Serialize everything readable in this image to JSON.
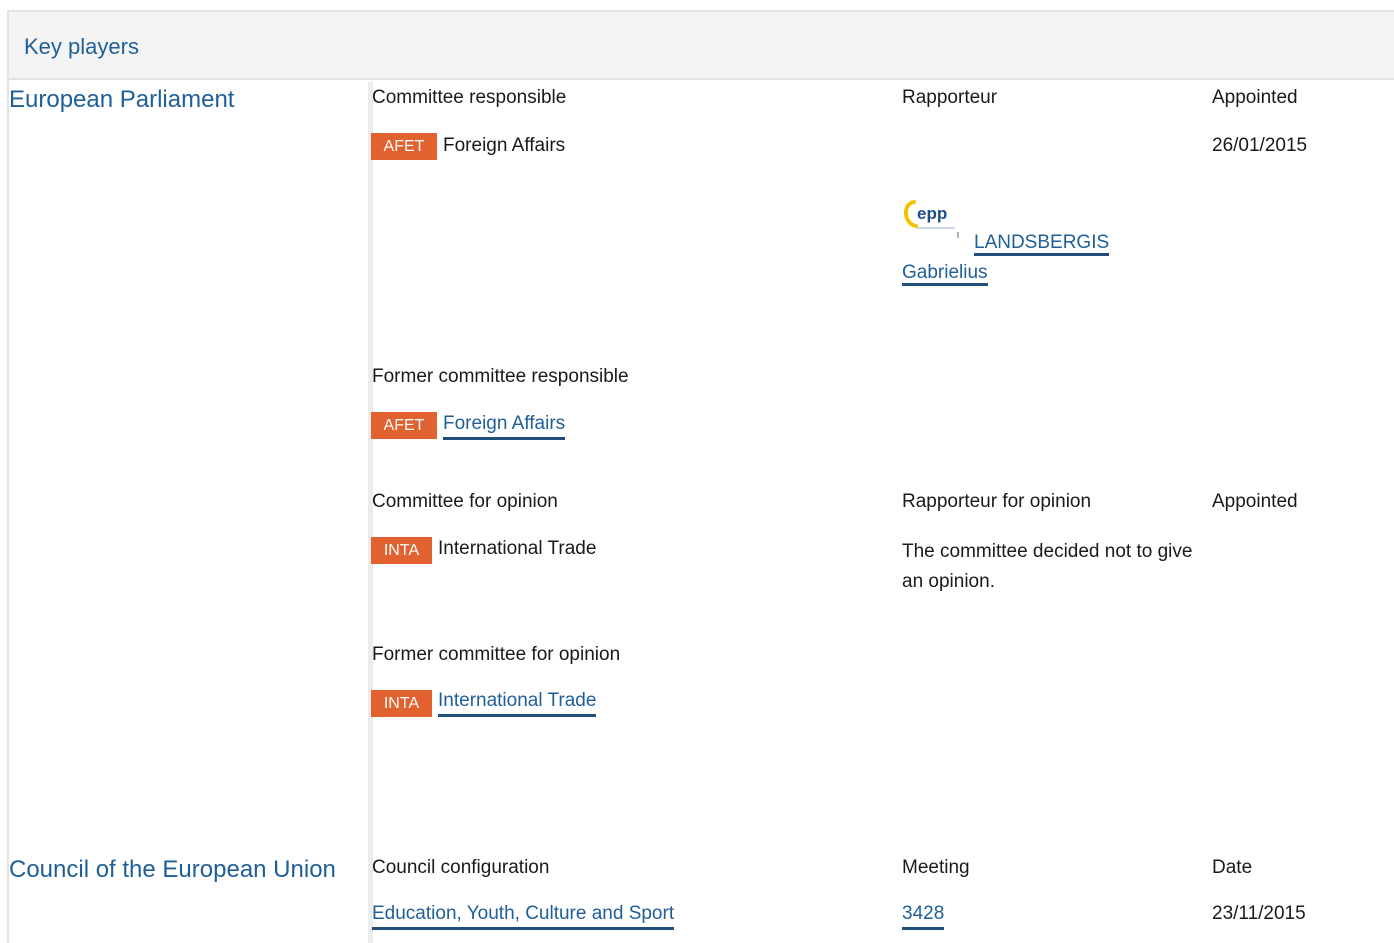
{
  "panel": {
    "title": "Key players"
  },
  "european_parliament": {
    "label": "European Parliament",
    "responsible": {
      "headers": {
        "committee": "Committee responsible",
        "rapporteur": "Rapporteur",
        "appointed": "Appointed"
      },
      "committee_code": "AFET",
      "committee_name": "Foreign Affairs",
      "rapporteur_name": "LANDSBERGIS Gabrielius",
      "appointed_date": "26/01/2015"
    },
    "former_responsible": {
      "header": "Former committee responsible",
      "committee_code": "AFET",
      "committee_name": "Foreign Affairs"
    },
    "opinion": {
      "headers": {
        "committee": "Committee for opinion",
        "rapporteur": "Rapporteur for opinion",
        "appointed": "Appointed"
      },
      "committee_code": "INTA",
      "committee_name": "International Trade",
      "note": "The committee decided not to give an opinion."
    },
    "former_opinion": {
      "header": "Former committee for opinion",
      "committee_code": "INTA",
      "committee_name": "International Trade"
    }
  },
  "council": {
    "label": "Council of the European Union",
    "headers": {
      "configuration": "Council configuration",
      "meeting": "Meeting",
      "date": "Date"
    },
    "configuration": "Education, Youth, Culture and Sport",
    "meeting": "3428",
    "date": "23/11/2015"
  },
  "colors": {
    "link": "#1f5f99",
    "badge": "#e1612f",
    "header_bg": "#f4f4f4"
  },
  "icons": {
    "party_logo": "epp-logo-icon"
  }
}
